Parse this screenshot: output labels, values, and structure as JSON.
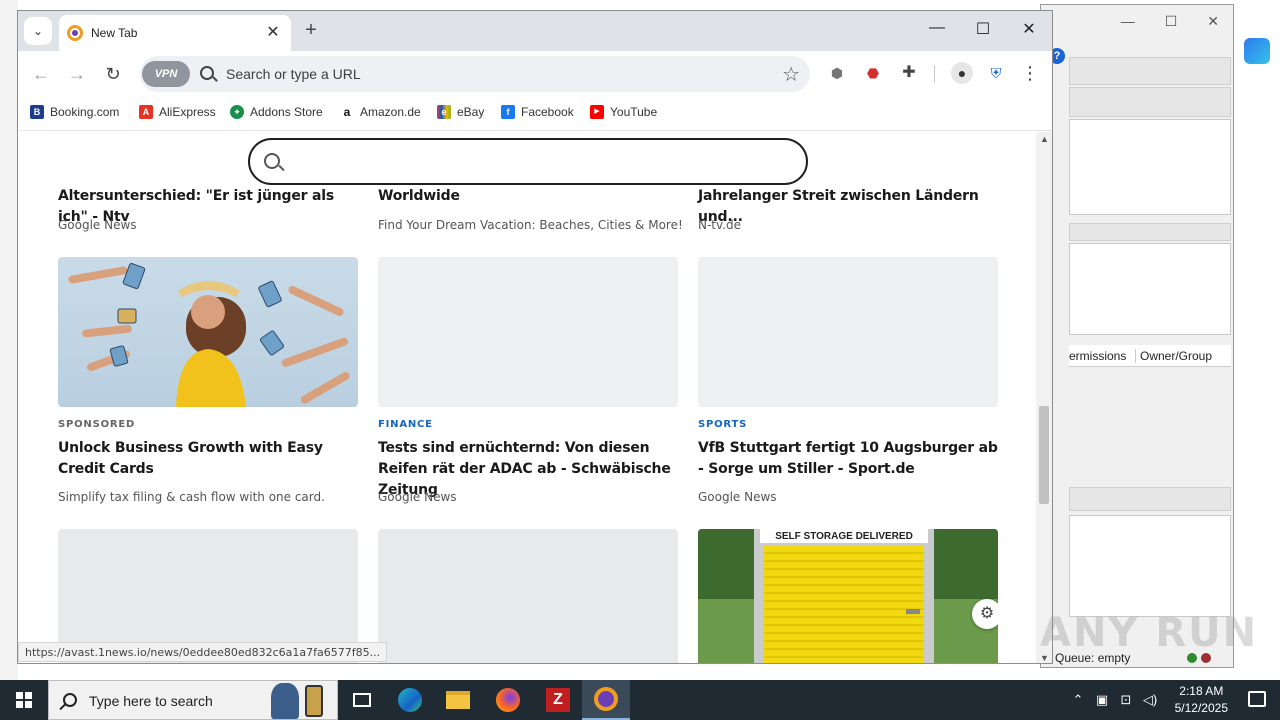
{
  "browser": {
    "tab_title": "New Tab",
    "new_tab": "+",
    "close_tab": "✕",
    "window": {
      "minimize": "—",
      "maximize": "☐",
      "close": "✕"
    },
    "omnibox": {
      "vpn_label": "VPN",
      "placeholder": "Search or type a URL"
    }
  },
  "bookmarks": [
    {
      "label": "Booking.com",
      "icon": "booking-icon",
      "icon_text": "B",
      "color": "#1c3d8f"
    },
    {
      "label": "AliExpress",
      "icon": "aliexpress-icon",
      "icon_text": "A",
      "color": "#e43225"
    },
    {
      "label": "Addons Store",
      "icon": "addons-store-icon",
      "icon_text": "✦",
      "color": "#1a8f4a"
    },
    {
      "label": "Amazon.de",
      "icon": "amazon-icon",
      "icon_text": "a",
      "color": "#ffffff"
    },
    {
      "label": "eBay",
      "icon": "ebay-icon",
      "icon_text": "e",
      "color": "#e53238"
    },
    {
      "label": "Facebook",
      "icon": "facebook-icon",
      "icon_text": "f",
      "color": "#1877f2"
    },
    {
      "label": "YouTube",
      "icon": "youtube-icon",
      "icon_text": "▶",
      "color": "#ff0000"
    }
  ],
  "feed": {
    "top_row": [
      {
        "title": "Altersunterschied: \"Er ist jünger als ich\" - Ntv",
        "source": "Google News"
      },
      {
        "title": "Worldwide",
        "source": "Find Your Dream Vacation: Beaches, Cities & More!"
      },
      {
        "title": "Jahrelanger Streit zwischen Ländern und...",
        "source": "N-tv.de"
      }
    ],
    "mid_row": [
      {
        "category": "SPONSORED",
        "category_color": "#666666",
        "title": "Unlock Business Growth with Easy Credit Cards",
        "source": "Simplify tax filing & cash flow with one card."
      },
      {
        "category": "FINANCE",
        "category_color": "#1565c0",
        "title": "Tests sind ernüchternd: Von diesen Reifen rät der ADAC ab - Schwäbische Zeitung",
        "source": "Google News"
      },
      {
        "category": "SPORTS",
        "category_color": "#1565c0",
        "title": "VfB Stuttgart fertigt 10 Augsburger ab - Sorge um Stiller - Sport.de",
        "source": "Google News"
      }
    ],
    "storage_banner": "SELF STORAGE DELIVERED"
  },
  "status_url": "https://avast.1news.io/news/0eddee80ed832c6a1a7fa6577f85...",
  "bg_app": {
    "tab_permissions": "ermissions",
    "tab_owner": "Owner/Group",
    "queue": "Queue: empty"
  },
  "watermark": "ANY RUN",
  "taskbar": {
    "search_placeholder": "Type here to search",
    "time": "2:18 AM",
    "date": "5/12/2025"
  }
}
